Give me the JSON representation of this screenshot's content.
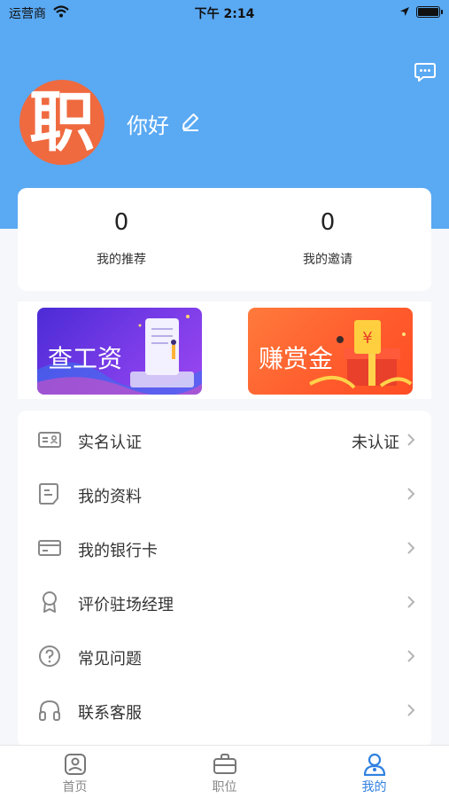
{
  "status_bar": {
    "carrier": "运营商",
    "time": "下午 2:14"
  },
  "profile": {
    "avatar_char": "职",
    "greeting": "你好"
  },
  "stats": [
    {
      "value": "0",
      "label": "我的推荐"
    },
    {
      "value": "0",
      "label": "我的邀请"
    }
  ],
  "banners": [
    {
      "text": "查工资"
    },
    {
      "text": "赚赏金"
    }
  ],
  "menu": [
    {
      "icon": "id-card-icon",
      "label": "实名认证",
      "value": "未认证"
    },
    {
      "icon": "document-icon",
      "label": "我的资料",
      "value": ""
    },
    {
      "icon": "bank-card-icon",
      "label": "我的银行卡",
      "value": ""
    },
    {
      "icon": "award-icon",
      "label": "评价驻场经理",
      "value": ""
    },
    {
      "icon": "question-icon",
      "label": "常见问题",
      "value": ""
    },
    {
      "icon": "headphones-icon",
      "label": "联系客服",
      "value": ""
    }
  ],
  "tabs": [
    {
      "icon": "home-icon",
      "label": "首页",
      "active": false
    },
    {
      "icon": "briefcase-icon",
      "label": "职位",
      "active": false
    },
    {
      "icon": "user-icon",
      "label": "我的",
      "active": true
    }
  ],
  "colors": {
    "header": "#5aa9f3",
    "accent": "#2f80e0",
    "avatar": "#ef6a3f"
  }
}
